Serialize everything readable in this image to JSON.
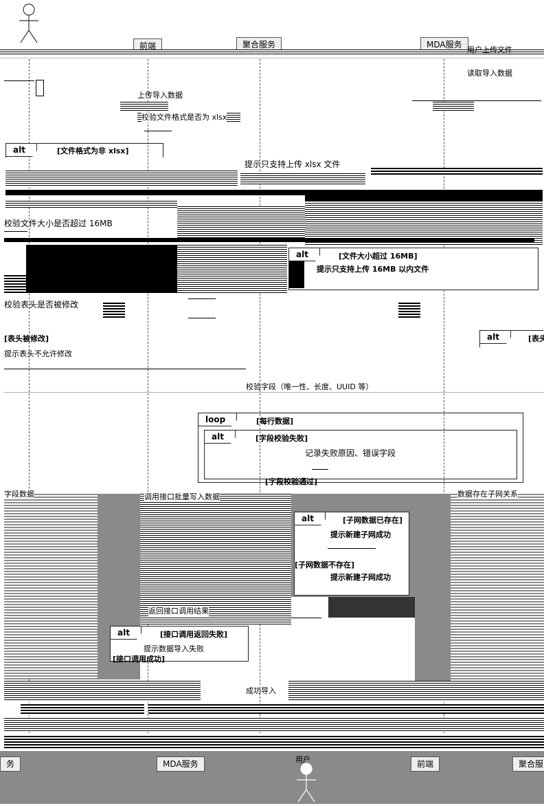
{
  "participants": {
    "top": [
      "前端",
      "聚合服务",
      "MDA服务"
    ],
    "bottom": [
      "务",
      "MDA服务",
      "前端",
      "聚合服"
    ],
    "actor_bottom_label": "用户"
  },
  "messages": {
    "upload": "上传导入数据",
    "check_format": "校验文件格式是否为 xlsx",
    "tip_xlsx": "提示只支持上传 xlsx 文件",
    "check_size": "校验文件大小是否超过 16MB",
    "tip_size": "提示只支持上传 16MB 以内文件",
    "check_header": "校验表头是否被修改",
    "tip_header": "提示表头不允许修改",
    "check_fields": "校验字段（唯一性、长度、UUID 等）",
    "record_fail": "记录失败原因、错误字段",
    "call_interface": "调用接口批量写入数据",
    "tip_child_exists": "提示新建子网成功",
    "tip_child_new": "提示新建子网成功",
    "interface_result": "返回接口调用结果",
    "tip_import_fail": "提示数据导入失败",
    "import_success": "成功导入"
  },
  "fragments": {
    "alt_format": {
      "tag": "alt",
      "guard": "[文件格式为非 xlsx]"
    },
    "alt_size": {
      "tag": "alt",
      "guard": "[文件大小超过 16MB]"
    },
    "alt_header_guard_left": "[表头被修改]",
    "alt_header_right": {
      "tag": "alt",
      "guard": "[表头"
    },
    "loop_rows": {
      "tag": "loop",
      "guard": "[每行数据]"
    },
    "alt_field": {
      "tag": "alt",
      "guard": "[字段校验失败]"
    },
    "field_ok_guard": "[字段校验通过]",
    "alt_child": {
      "tag": "alt",
      "guard": "[子网数据已存在]"
    },
    "child_else_guard": "[子网数据不存在]",
    "alt_interface": {
      "tag": "alt",
      "guard": "[接口调用返回失败]"
    },
    "interface_else_guard": "[接口调用成功]"
  },
  "side_notes": {
    "top_right_1": "用户上传文件",
    "top_right_2": "读取导入数据",
    "row_note": "字段数据",
    "row_note_right": "数据存在子网关系"
  }
}
